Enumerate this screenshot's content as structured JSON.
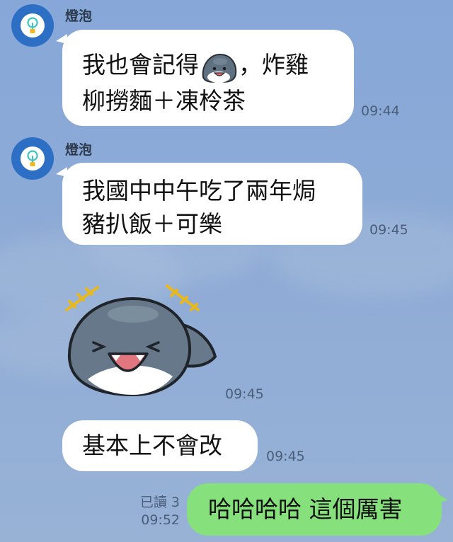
{
  "theme": {
    "background": "#8aa9d6",
    "incoming_bubble": "#ffffff",
    "outgoing_bubble": "#86e07c",
    "avatar_color": "#2c6fc4",
    "sticker_body": "#5f7180",
    "sticker_accent": "#f2c21b"
  },
  "messages": [
    {
      "sender": "燈泡",
      "avatar_icon": "lightbulb-icon",
      "text_a": "我也會記得",
      "text_b": "，炸雞",
      "line2": "柳撈麵＋凍柃茶",
      "time": "09:44"
    },
    {
      "sender": "燈泡",
      "avatar_icon": "lightbulb-icon",
      "line1": "我國中中午吃了兩年焗",
      "line2": "豬扒飯＋可樂",
      "time": "09:45"
    },
    {
      "type": "sticker",
      "sticker": "laughing-dolphin-sticker",
      "time": "09:45"
    },
    {
      "text": "基本上不會改",
      "time": "09:45"
    },
    {
      "outgoing": true,
      "text": "哈哈哈哈 這個厲害",
      "read": "已讀 3",
      "time": "09:52"
    }
  ]
}
